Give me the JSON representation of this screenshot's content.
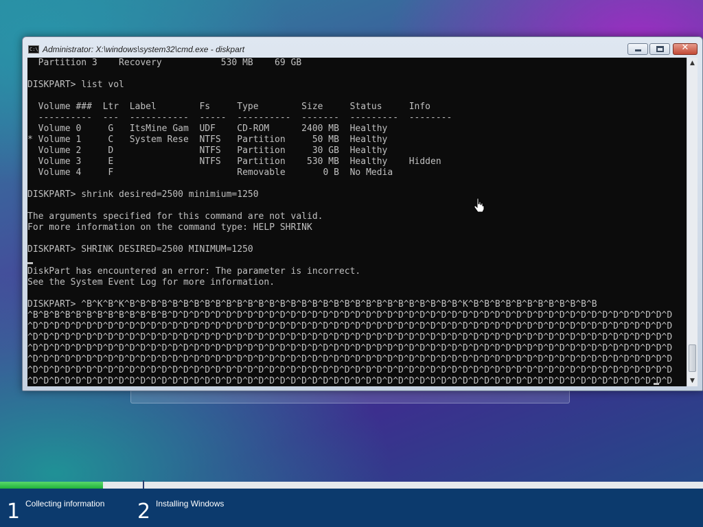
{
  "window": {
    "title": "Administrator: X:\\windows\\system32\\cmd.exe - diskpart",
    "icon": "cmd-icon",
    "close_glyph": "✕"
  },
  "console": {
    "lines": [
      "  Partition 3    Recovery           530 MB    69 GB",
      "",
      "DISKPART> list vol",
      "",
      "  Volume ###  Ltr  Label        Fs     Type        Size     Status     Info",
      "  ----------  ---  -----------  -----  ----------  -------  ---------  --------",
      "  Volume 0     G   ItsMine Gam  UDF    CD-ROM      2400 MB  Healthy",
      "* Volume 1     C   System Rese  NTFS   Partition     50 MB  Healthy",
      "  Volume 2     D                NTFS   Partition     30 GB  Healthy",
      "  Volume 3     E                NTFS   Partition    530 MB  Healthy    Hidden",
      "  Volume 4     F                       Removable       0 B  No Media",
      "",
      "DISKPART> shrink desired=2500 minimium=1250",
      "",
      "The arguments specified for this command are not valid.",
      "For more information on the command type: HELP SHRINK",
      "",
      "DISKPART> SHRINK DESIRED=2500 MINIMUM=1250",
      "",
      "DiskPart has encountered an error: The parameter is incorrect.",
      "See the System Event Log for more information.",
      "",
      "DISKPART> ^B^K^B^K^B^B^B^B^B^B^B^B^B^B^B^B^B^B^B^B^B^B^B^B^B^B^B^B^B^B^B^B^B^B^B^K^B^B^B^B^B^B^B^B^B^B^B^B",
      "^B^B^B^B^B^B^B^B^B^B^B^B^B^D^D^D^D^D^D^D^D^D^D^D^D^D^D^D^D^D^D^D^D^D^D^D^D^D^D^D^D^D^D^D^D^D^D^D^D^D^D^D^D^D^D^D^D^D^D^D",
      "^D^D^D^D^D^D^D^D^D^D^D^D^D^D^D^D^D^D^D^D^D^D^D^D^D^D^D^D^D^D^D^D^D^D^D^D^D^D^D^D^D^D^D^D^D^D^D^D^D^D^D^D^D^D^D^D^D^D^D^D",
      "^D^D^D^D^D^D^D^D^D^D^D^D^D^D^D^D^D^D^D^D^D^D^D^D^D^D^D^D^D^D^D^D^D^D^D^D^D^D^D^D^D^D^D^D^D^D^D^D^D^D^D^D^D^D^D^D^D^D^D^D",
      "^D^D^D^D^D^D^D^D^D^D^D^D^D^D^D^D^D^D^D^D^D^D^D^D^D^D^D^D^D^D^D^D^D^D^D^D^D^D^D^D^D^D^D^D^D^D^D^D^D^D^D^D^D^D^D^D^D^D^D^D",
      "^D^D^D^D^D^D^D^D^D^D^D^D^D^D^D^D^D^D^D^D^D^D^D^D^D^D^D^D^D^D^D^D^D^D^D^D^D^D^D^D^D^D^D^D^D^D^D^D^D^D^D^D^D^D^D^D^D^D^D^D",
      "^D^D^D^D^D^D^D^D^D^D^D^D^D^D^D^D^D^D^D^D^D^D^D^D^D^D^D^D^D^D^D^D^D^D^D^D^D^D^D^D^D^D^D^D^D^D^D^D^D^D^D^D^D^D^D^D^D^D^D^D",
      "^D^D^D^D^D^D^D^D^D^D^D^D^D^D^D^D^D^D^D^D^D^D^D^D^D^D^D^D^D^D^D^D^D^D^D^D^D^D^D^D^D^D^D^D^D^D^D^D^D^D^D^D^D^D^D^D^D^D^D^D",
      "^D^D^D^D^D^D^D^D^D^D^D^D^D^D^D^D^D^D^D^D^D^D^D^D^D^D^D^D^D^D^D^D^D^D^D^D^D^D^D^D^D^D^D^D^D^D^D^D^D^D^D^D^D^D^D^D^D"
    ]
  },
  "setup": {
    "progress": 0.146,
    "steps": [
      {
        "number": "1",
        "label": "Collecting information"
      },
      {
        "number": "2",
        "label": "Installing Windows"
      }
    ]
  },
  "colors": {
    "progress_fill": "#21b23a",
    "footer": "#0c3a6d",
    "console_bg": "#0c0c0c",
    "console_text": "#c0c0c0"
  }
}
